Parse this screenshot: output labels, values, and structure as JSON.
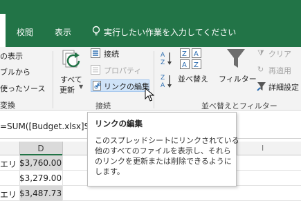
{
  "tabs": [
    {
      "label": "校閲"
    },
    {
      "label": "表示"
    }
  ],
  "tell_me": "実行したい作業を入力してください",
  "ribbon": {
    "left_items": [
      "の表示",
      "ブルから",
      "使ったソース",
      "変換"
    ],
    "refresh_all": {
      "line1": "すべて",
      "line2": "更新"
    },
    "connections_group": {
      "connections": "接続",
      "properties": "プロパティ",
      "edit_links": "リンクの編集",
      "label": "接続"
    },
    "sort_group": {
      "sort": "並べ替え",
      "filter": "フィルター",
      "clear": "クリア",
      "reapply": "再適用",
      "advanced": "詳細設定",
      "label": "並べ替えとフィルター"
    }
  },
  "formula_bar": {
    "text": "=SUM([Budget.xlsx]S"
  },
  "grid": {
    "columns": [
      "D",
      "I"
    ],
    "rows": [
      {
        "left": "エリ",
        "d": "$3,760.00"
      },
      {
        "left": "",
        "d": "$3,279.00"
      },
      {
        "left": "エリ",
        "d": "$3,487.73"
      }
    ]
  },
  "tooltip": {
    "title": "リンクの編集",
    "lines": [
      "このスプレッドシートにリンクされている",
      "他のすべてのファイルを表示し、それら",
      "のリンクを更新または削除できるように",
      "します。"
    ]
  },
  "colors": {
    "excel_green": "#227447",
    "ribbon_bg": "#f3f3f3",
    "selection": "#d9d9d9"
  }
}
